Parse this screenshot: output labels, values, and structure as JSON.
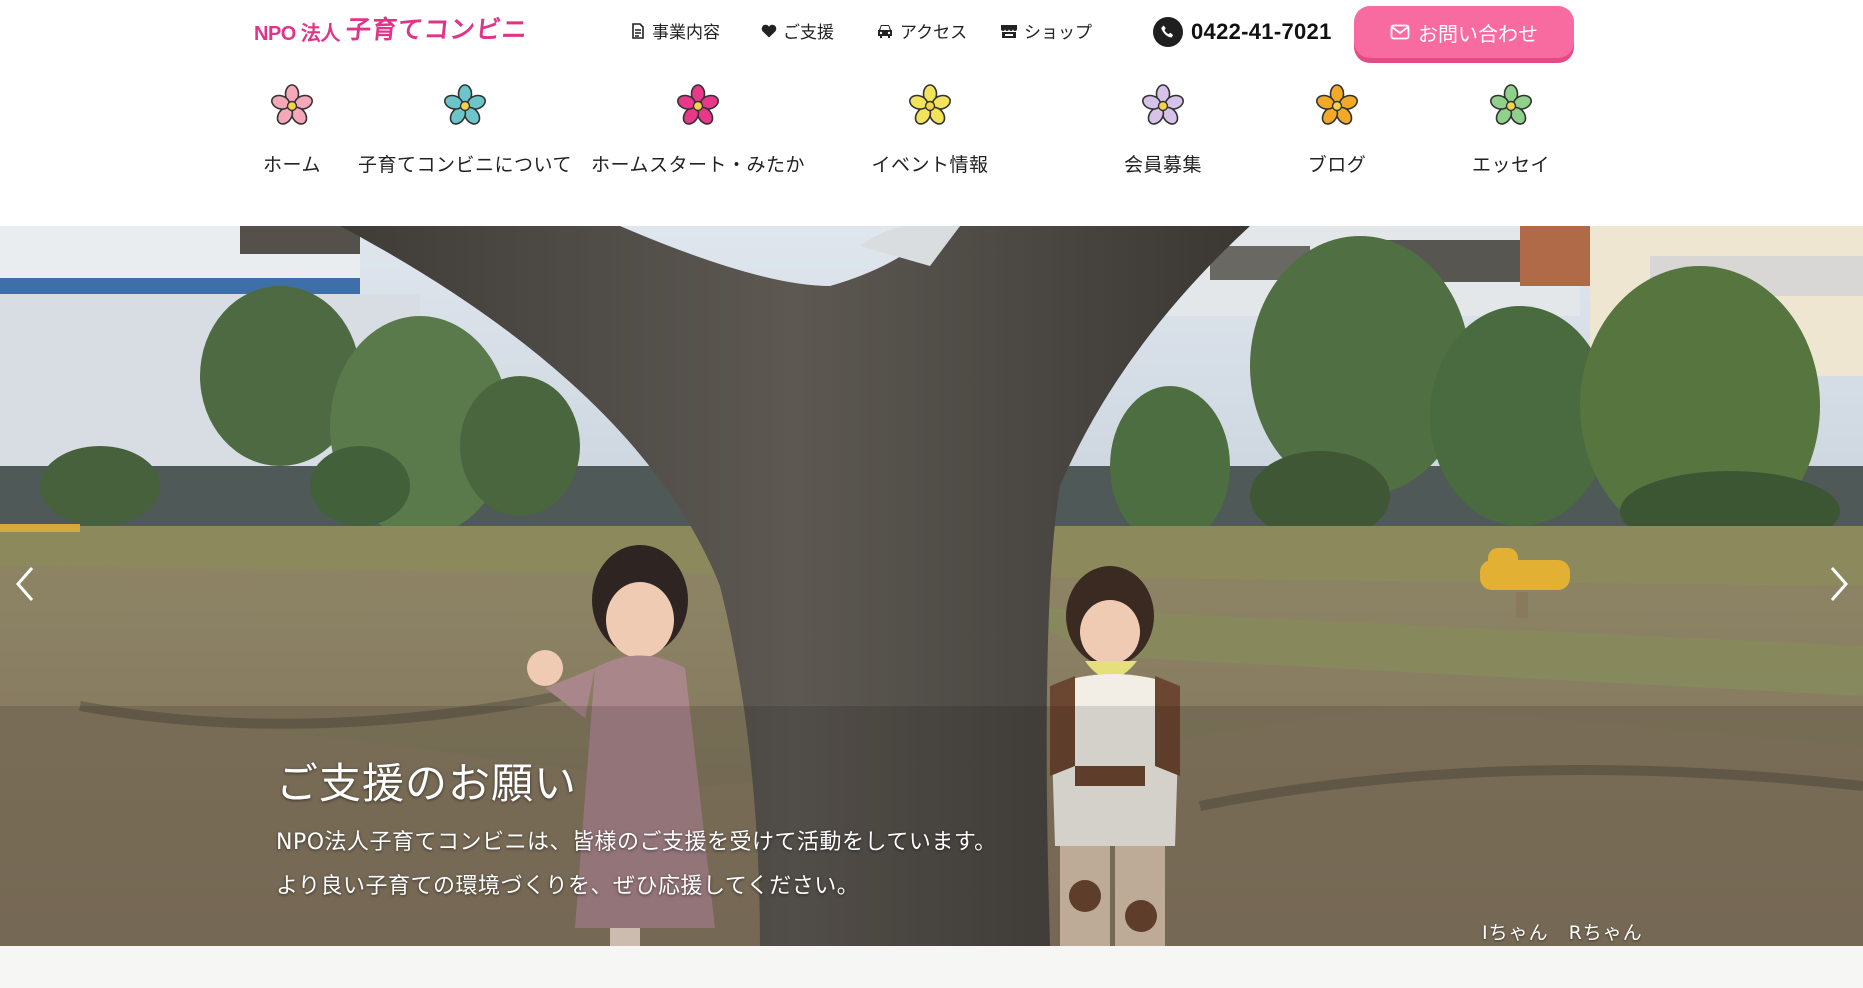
{
  "logo": {
    "prefix": "NPO 法人",
    "name": "子育てコンビニ"
  },
  "utility_nav": [
    {
      "label": "事業内容",
      "icon": "document-icon"
    },
    {
      "label": "ご支援",
      "icon": "heart-icon"
    },
    {
      "label": "アクセス",
      "icon": "car-icon"
    },
    {
      "label": "ショップ",
      "icon": "store-icon"
    }
  ],
  "phone": {
    "number": "0422-41-7021",
    "icon": "phone-icon"
  },
  "contact": {
    "label": "お問い合わせ",
    "icon": "envelope-icon"
  },
  "main_nav": [
    {
      "label": "ホーム",
      "icon": "flower-icon",
      "color": "#f7a8b8"
    },
    {
      "label": "子育てコンビニについて",
      "icon": "flower-icon",
      "color": "#6cc6c9"
    },
    {
      "label": "ホームスタート・みたか",
      "icon": "flower-icon",
      "color": "#e8388a"
    },
    {
      "label": "イベント情報",
      "icon": "flower-icon",
      "color": "#f2e35a"
    },
    {
      "label": "会員募集",
      "icon": "flower-icon",
      "color": "#d7c3ea"
    },
    {
      "label": "ブログ",
      "icon": "flower-icon",
      "color": "#f3a928"
    },
    {
      "label": "エッセイ",
      "icon": "flower-icon",
      "color": "#8fd08a"
    }
  ],
  "hero": {
    "title": "ご支援のお願い",
    "line1": "NPO法人子育てコンビニは、皆様のご支援を受けて活動をしています。",
    "line2": "より良い子育ての環境づくりを、ぜひ応援してください。",
    "credit": "Iちゃん　Rちゃん"
  },
  "colors": {
    "accent": "#f76ba0",
    "brand": "#e0348a"
  }
}
